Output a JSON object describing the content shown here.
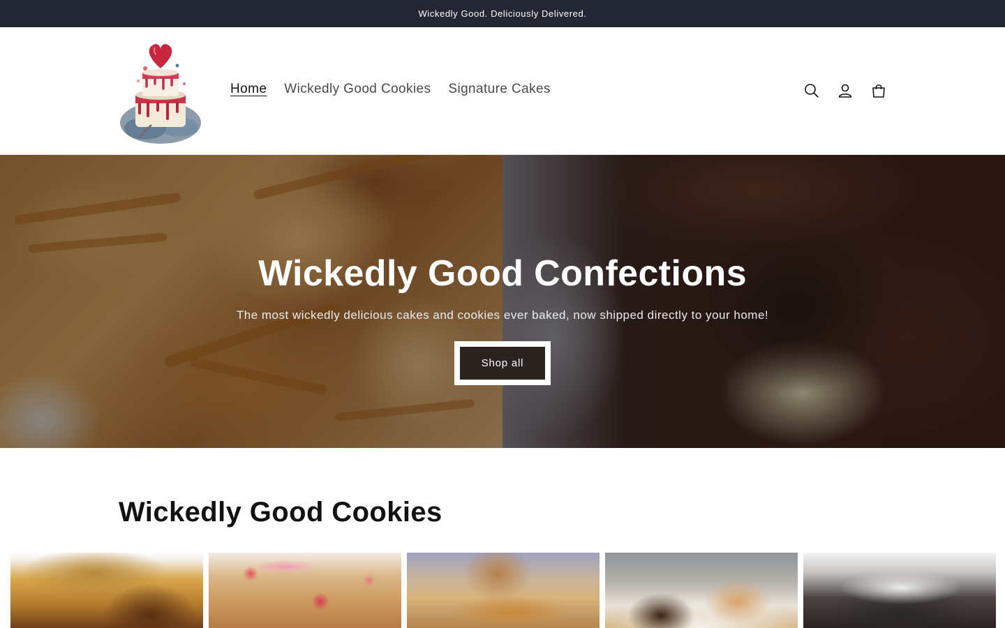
{
  "announcement": {
    "text": "Wickedly Good. Deliciously Delivered."
  },
  "header": {
    "nav": [
      {
        "label": "Home",
        "active": true
      },
      {
        "label": "Wickedly Good Cookies",
        "active": false
      },
      {
        "label": "Signature Cakes",
        "active": false
      }
    ],
    "icons": [
      "search-icon",
      "account-icon",
      "cart-icon"
    ]
  },
  "hero": {
    "title": "Wickedly Good Confections",
    "subtitle": "The most wickedly delicious cakes and cookies ever baked, now shipped directly to your home!",
    "button_label": "Shop all"
  },
  "collection": {
    "title": "Wickedly Good Cookies",
    "products": [
      {
        "image": "peanut-butter-cup-cookie"
      },
      {
        "image": "strawberry-cookie"
      },
      {
        "image": "biscoff-cookie"
      },
      {
        "image": "smores-cookie"
      },
      {
        "image": "cookies-and-cream-cookie"
      }
    ]
  },
  "colors": {
    "announcement_bg": "#232733",
    "text": "#121212",
    "hero_button_bg": "#2b231f"
  }
}
